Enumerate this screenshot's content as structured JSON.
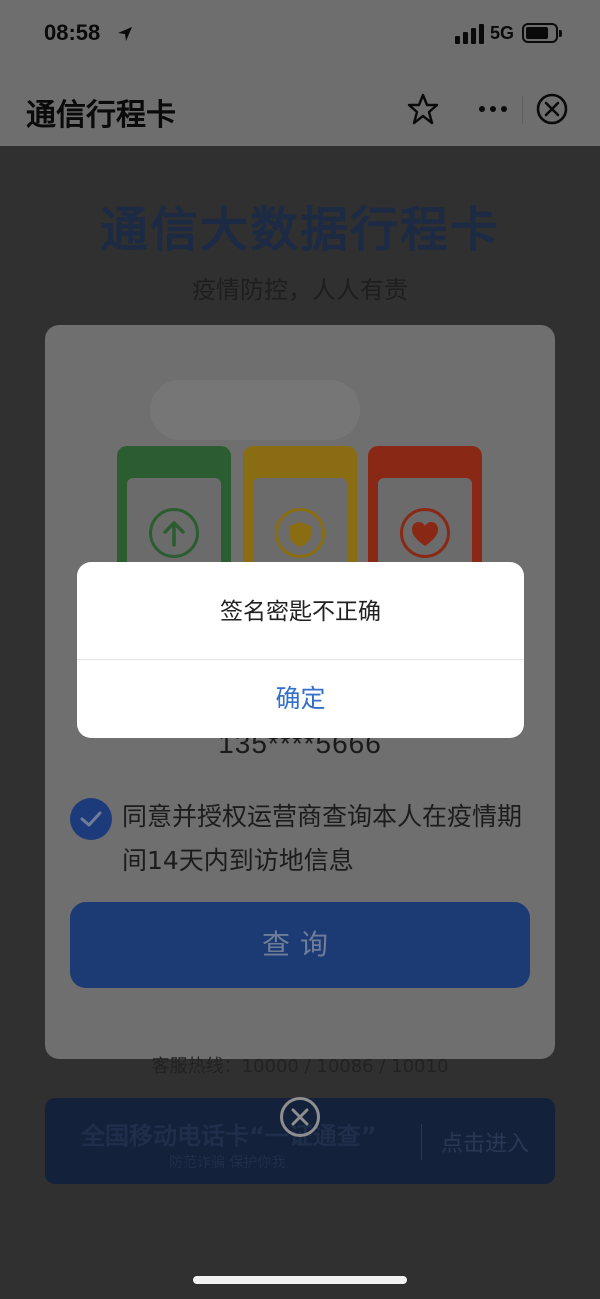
{
  "status_bar": {
    "time": "08:58",
    "network": "5G",
    "location_icon": "location-arrow-icon",
    "signal_icon": "signal-bars-icon",
    "battery_icon": "battery-icon"
  },
  "nav_bar": {
    "title": "通信行程卡",
    "favorite_icon": "star-icon",
    "more_icon": "more-dots-icon",
    "close_icon": "close-circle-icon"
  },
  "page": {
    "hero_title": "通信大数据行程卡",
    "hero_subtitle": "疫情防控，人人有责",
    "phone_icons": [
      "arrow-up-icon",
      "shield-icon",
      "heart-icon"
    ],
    "phone_number": "135****5666",
    "agreement_text": "同意并授权运营商查询本人在疫情期间14天内到访地信息",
    "query_button": "查询",
    "hotline": "客服热线：10000 / 10086 / 10010",
    "banner": {
      "title": "全国移动电话卡“一证通查”",
      "subtitle": "防范诈骗 保护你我",
      "enter": "点击进入"
    }
  },
  "dialog": {
    "message": "签名密匙不正确",
    "confirm_button": "确定"
  },
  "colors": {
    "dialog_button": "#3570c8",
    "overlay": "#303030"
  }
}
